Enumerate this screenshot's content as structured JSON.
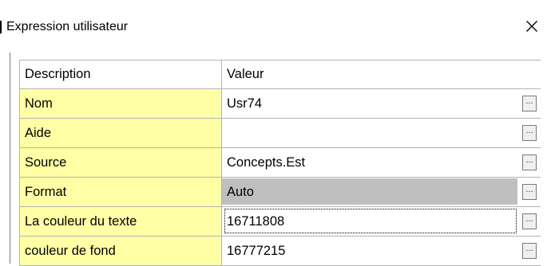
{
  "window": {
    "title": "Expression utilisateur"
  },
  "grid": {
    "columns": [
      "Description",
      "Valeur"
    ],
    "rows": [
      {
        "label": "Nom",
        "value": "Usr74"
      },
      {
        "label": "Aide",
        "value": ""
      },
      {
        "label": "Source",
        "value": "Concepts.Est"
      },
      {
        "label": "Format",
        "value": "Auto"
      },
      {
        "label": "La couleur du texte",
        "value": "16711808"
      },
      {
        "label": "couleur de fond",
        "value": "16777215"
      }
    ],
    "ellipsis_label": "...",
    "selected_row": "Format",
    "focused_row": "La couleur du texte"
  },
  "colors": {
    "label_cell_bg": "#ffffa6",
    "selected_bg": "#bfbfbf",
    "grid_line": "#b4b4b4"
  }
}
